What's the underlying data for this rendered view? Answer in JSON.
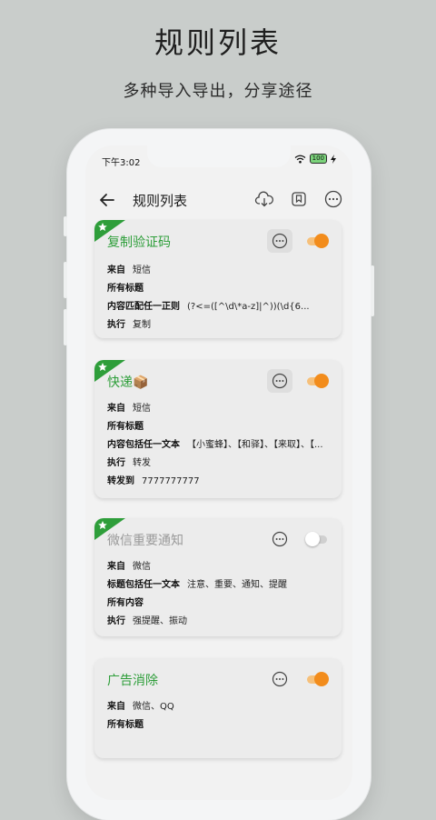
{
  "promo": {
    "title": "规则列表",
    "subtitle": "多种导入导出，分享途径"
  },
  "status_bar": {
    "time": "下午3:02",
    "battery": "100",
    "icons": [
      "wifi-icon",
      "battery-icon",
      "charging-icon"
    ]
  },
  "appbar": {
    "title": "规则列表",
    "icons": [
      "back-arrow-icon",
      "cloud-download-icon",
      "bookmark-icon",
      "more-icon"
    ]
  },
  "colors": {
    "accent_green": "#2e9e3a",
    "toggle_on": "#f28c1c",
    "disabled_title": "#9a9a9a"
  },
  "rules": [
    {
      "title": "复制验证码",
      "enabled": true,
      "lines": [
        {
          "key": "来自",
          "value": "短信"
        },
        {
          "key": "所有标题",
          "value": ""
        },
        {
          "key": "内容匹配任一正则",
          "value": "(?<=([^\\d\\*a-z]|^))(\\d{6..."
        },
        {
          "key": "执行",
          "value": "复制"
        }
      ]
    },
    {
      "title": "快递📦",
      "enabled": true,
      "lines": [
        {
          "key": "来自",
          "value": "短信"
        },
        {
          "key": "所有标题",
          "value": ""
        },
        {
          "key": "内容包括任一文本",
          "value": "【小蜜蜂】、【和驿】、【来取】、【..."
        },
        {
          "key": "执行",
          "value": "转发"
        },
        {
          "key": "转发到",
          "value": "7777777777"
        }
      ]
    },
    {
      "title": "微信重要通知",
      "enabled": false,
      "lines": [
        {
          "key": "来自",
          "value": "微信"
        },
        {
          "key": "标题包括任一文本",
          "value": "注意、重要、通知、提醒"
        },
        {
          "key": "所有内容",
          "value": ""
        },
        {
          "key": "执行",
          "value": "强提醒、振动"
        }
      ]
    },
    {
      "title": "广告消除",
      "enabled": true,
      "lines": [
        {
          "key": "来自",
          "value": "微信、QQ"
        },
        {
          "key": "所有标题",
          "value": ""
        }
      ]
    }
  ]
}
